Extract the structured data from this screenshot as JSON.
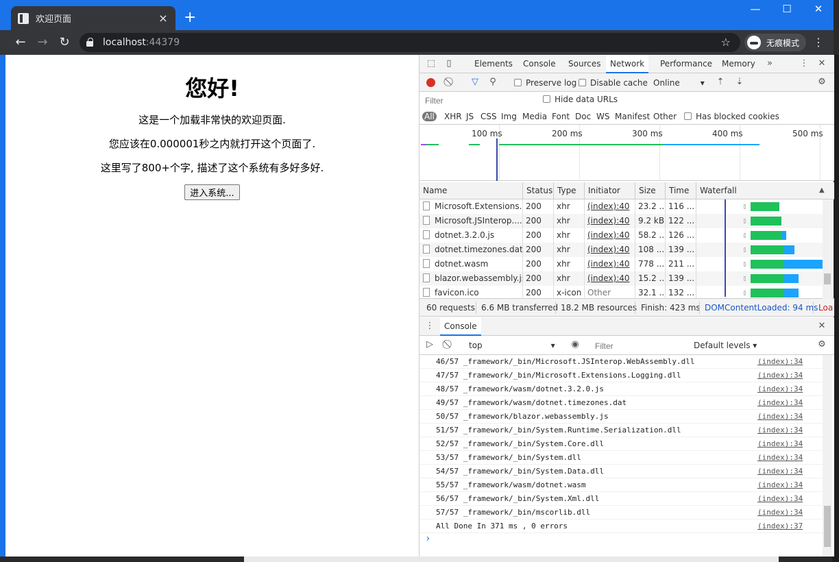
{
  "browser": {
    "tab_title": "欢迎页面",
    "tab_close": "×",
    "new_tab": "+",
    "min": "—",
    "max": "☐",
    "close": "✕",
    "back": "←",
    "forward": "→",
    "reload": "↻",
    "url_host": "localhost",
    "url_port": ":44379",
    "star": "☆",
    "incognito_label": "无痕模式",
    "menu": "⋮"
  },
  "page": {
    "heading": "您好!",
    "line1": "这是一个加载非常快的欢迎页面.",
    "line2": "您应该在0.000001秒之内就打开这个页面了.",
    "line3": "这里写了800+个字, 描述了这个系统有多好多好.",
    "enter_button": "进入系统..."
  },
  "devtools": {
    "tabs": [
      "Elements",
      "Console",
      "Sources",
      "Network",
      "Performance",
      "Memory"
    ],
    "more_tabs": "»",
    "active_tab": "Network",
    "preserve_log": "Preserve log",
    "disable_cache": "Disable cache",
    "throttle": "Online",
    "filter_placeholder": "Filter",
    "hide_data_urls": "Hide data URLs",
    "types": [
      "All",
      "XHR",
      "JS",
      "CSS",
      "Img",
      "Media",
      "Font",
      "Doc",
      "WS",
      "Manifest",
      "Other"
    ],
    "has_blocked_cookies": "Has blocked cookies",
    "overview_ticks": [
      "100 ms",
      "200 ms",
      "300 ms",
      "400 ms",
      "500 ms"
    ],
    "columns": [
      "Name",
      "Status",
      "Type",
      "Initiator",
      "Size",
      "Time",
      "Waterfall"
    ],
    "requests": [
      {
        "name": "Microsoft.Extensions....",
        "status": "200",
        "type": "xhr",
        "initiator": "(index):40",
        "size": "23.2 ...",
        "time": "116 ...",
        "wf_start": 0.11,
        "wf_wait": 0.0,
        "wf_recv": 0.52
      },
      {
        "name": "Microsoft.JSInterop....",
        "status": "200",
        "type": "xhr",
        "initiator": "(index):40",
        "size": "9.2 kB",
        "time": "122 ...",
        "wf_start": 0.11,
        "wf_wait": 0.0,
        "wf_recv": 0.55
      },
      {
        "name": "dotnet.3.2.0.js",
        "status": "200",
        "type": "xhr",
        "initiator": "(index):40",
        "size": "58.2 ...",
        "time": "126 ...",
        "wf_start": 0.11,
        "wf_wait": 0.0,
        "wf_recv": 0.57
      },
      {
        "name": "dotnet.timezones.dat",
        "status": "200",
        "type": "xhr",
        "initiator": "(index):40",
        "size": "108 ...",
        "time": "139 ...",
        "wf_start": 0.11,
        "wf_wait": 0.0,
        "wf_recv": 0.6
      },
      {
        "name": "dotnet.wasm",
        "status": "200",
        "type": "xhr",
        "initiator": "(index):40",
        "size": "778 ...",
        "time": "211 ...",
        "wf_start": 0.11,
        "wf_wait": 0.0,
        "wf_recv": 0.75
      },
      {
        "name": "blazor.webassembly.js",
        "status": "200",
        "type": "xhr",
        "initiator": "(index):40",
        "size": "15.2 ...",
        "time": "139 ...",
        "wf_start": 0.11,
        "wf_wait": 0.0,
        "wf_recv": 0.62
      },
      {
        "name": "favicon.ico",
        "status": "200",
        "type": "x-icon",
        "initiator": "Other",
        "size": "32.1 ...",
        "time": "132 ...",
        "wf_start": 0.11,
        "wf_wait": 0.0,
        "wf_recv": 0.62
      }
    ],
    "summary": {
      "requests": "60 requests",
      "transferred": "6.6 MB transferred",
      "resources": "18.2 MB resources",
      "finish": "Finish: 423 ms",
      "dcl": "DOMContentLoaded: 94 ms",
      "load": "Loa"
    },
    "drawer_tab": "Console",
    "context": "top",
    "console_filter_placeholder": "Filter",
    "default_levels": "Default levels ▾",
    "log": [
      {
        "text": "46/57 _framework/_bin/Microsoft.JSInterop.WebAssembly.dll",
        "src": "(index):34"
      },
      {
        "text": "47/57 _framework/_bin/Microsoft.Extensions.Logging.dll",
        "src": "(index):34"
      },
      {
        "text": "48/57 _framework/wasm/dotnet.3.2.0.js",
        "src": "(index):34"
      },
      {
        "text": "49/57 _framework/wasm/dotnet.timezones.dat",
        "src": "(index):34"
      },
      {
        "text": "50/57 _framework/blazor.webassembly.js",
        "src": "(index):34"
      },
      {
        "text": "51/57 _framework/_bin/System.Runtime.Serialization.dll",
        "src": "(index):34"
      },
      {
        "text": "52/57 _framework/_bin/System.Core.dll",
        "src": "(index):34"
      },
      {
        "text": "53/57 _framework/_bin/System.dll",
        "src": "(index):34"
      },
      {
        "text": "54/57 _framework/_bin/System.Data.dll",
        "src": "(index):34"
      },
      {
        "text": "55/57 _framework/wasm/dotnet.wasm",
        "src": "(index):34"
      },
      {
        "text": "56/57 _framework/_bin/System.Xml.dll",
        "src": "(index):34"
      },
      {
        "text": "57/57 _framework/_bin/mscorlib.dll",
        "src": "(index):34"
      },
      {
        "text": "All Done In 371 ms , 0 errors",
        "src": "(index):37"
      }
    ],
    "prompt": "›"
  },
  "colors": {
    "accent": "#1a73e8",
    "recv": "#1fc15a",
    "wasm": "#1aa3ff",
    "dcl": "#3b4ba8"
  }
}
